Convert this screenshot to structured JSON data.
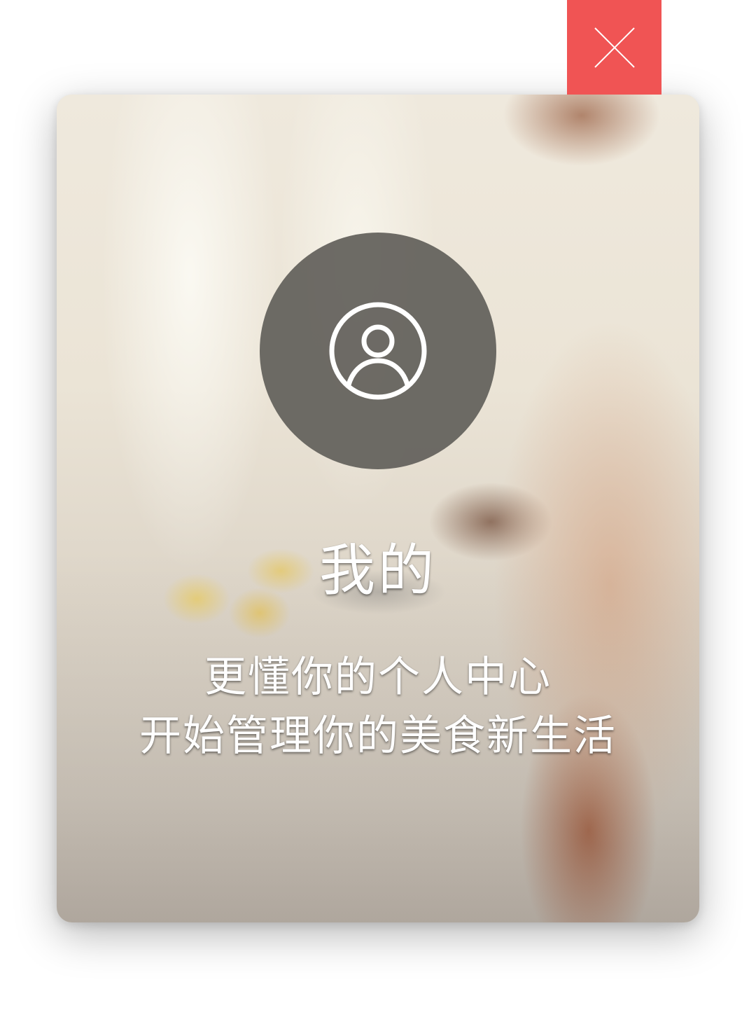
{
  "dialog": {
    "title": "我的",
    "subtitle_lines": [
      "更懂你的个人中心",
      "开始管理你的美食新生活"
    ],
    "avatar_icon": "user-circle-icon",
    "close_icon": "close-icon"
  },
  "colors": {
    "close_button": "#f05454",
    "avatar_circle": "#64625c",
    "text": "#ffffff"
  }
}
